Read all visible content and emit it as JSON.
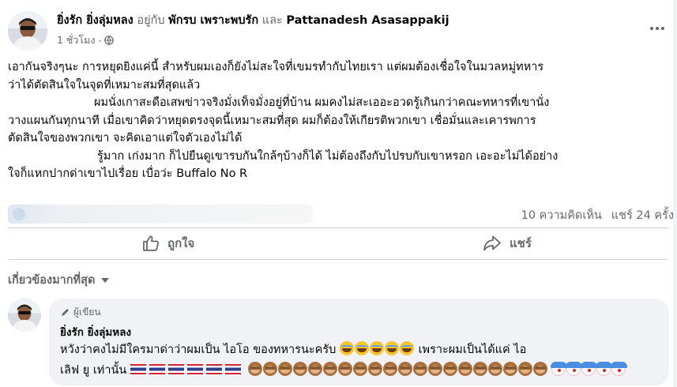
{
  "post": {
    "author_name": "ยิ่งรัก ยิ่งลุ่มหลง",
    "with_word": "อยู่กับ",
    "tagged_1": "พักรบ เพราะพบรัก",
    "and_word": "และ",
    "tagged_2": "Pattanadesh Asasappakij",
    "time": "1 ชั่วโมง",
    "privacy_dot": "·",
    "privacy_icon": "globe-icon",
    "more_icon": "more-options-icon",
    "lines": [
      "เอากันจริงๆนะ การหยุดยิงแค่นี้ สำหรับผมเองก็ยังไม่สะใจที่เขมรทำกับไทยเรา แต่ผมต้องเชื่อใจในมวลหมู่ทหาร",
      "ว่าได้ตัดสินใจในจุดที่เหมาะสมที่สุดแล้ว",
      "ผมนั่งเกาสะดือเสพข่าวจริงมั่งเท็จมั่งอยู่ที่บ้าน ผมคงไม่สะเออะอวดรู้เกินกว่าคณะทหารที่เขานั่ง",
      "วางแผนกันทุกนาที เมื่อเขาคิดว่าหยุดตรงจุดนี้เหมาะสมที่สุด ผมก็ต้องให้เกียรติพวกเขา เชื่อมั่นและเคารพการ",
      "ตัดสินใจของพวกเขา จะคิดเอาแต่ใจตัวเองไม่ได้",
      "รู้มาก เก่งมาก ก็ไปยืนดูเขารบกันใกล้ๆบ้างก็ได้ ไม่ต้องถึงกับไปรบกับเขาหรอก เอะอะไม่ได้อย่าง",
      "ใจก็แหกปากด่าเขาไปเรื่อย เบื่อว่ะ Buffalo No R"
    ],
    "comments_count": "10 ความคิดเห็น",
    "shares_count": "แชร์ 24 ครั้ง",
    "like_label": "ถูกใจ",
    "share_label": "แชร์"
  },
  "filter": {
    "label": "เกี่ยวข้องมากที่สุด"
  },
  "comment": {
    "badge": "ผู้เขียน",
    "author_name": "ยิ่งรัก ยิ่งลุ่มหลง",
    "line1_text": "หวังว่าคงไม่มีใครมาด่าว่าผมเป็น ไอโอ ของทหารนะครับ",
    "line1_tail": "เพราะผมเป็นได้แค่ ไอ",
    "line2_text": "เลิฟ ยู เท่านั้น",
    "emoji_laugh": "face-with-tears-of-joy",
    "emoji_flag": "flag-thailand",
    "emoji_monkey": "see-no-evil-monkey",
    "emoji_clown": "clown-face"
  },
  "colors": {
    "text_primary": "#050505",
    "text_secondary": "#65676b",
    "bubble_bg": "#f0f2f5",
    "divider": "#ced0d4"
  }
}
